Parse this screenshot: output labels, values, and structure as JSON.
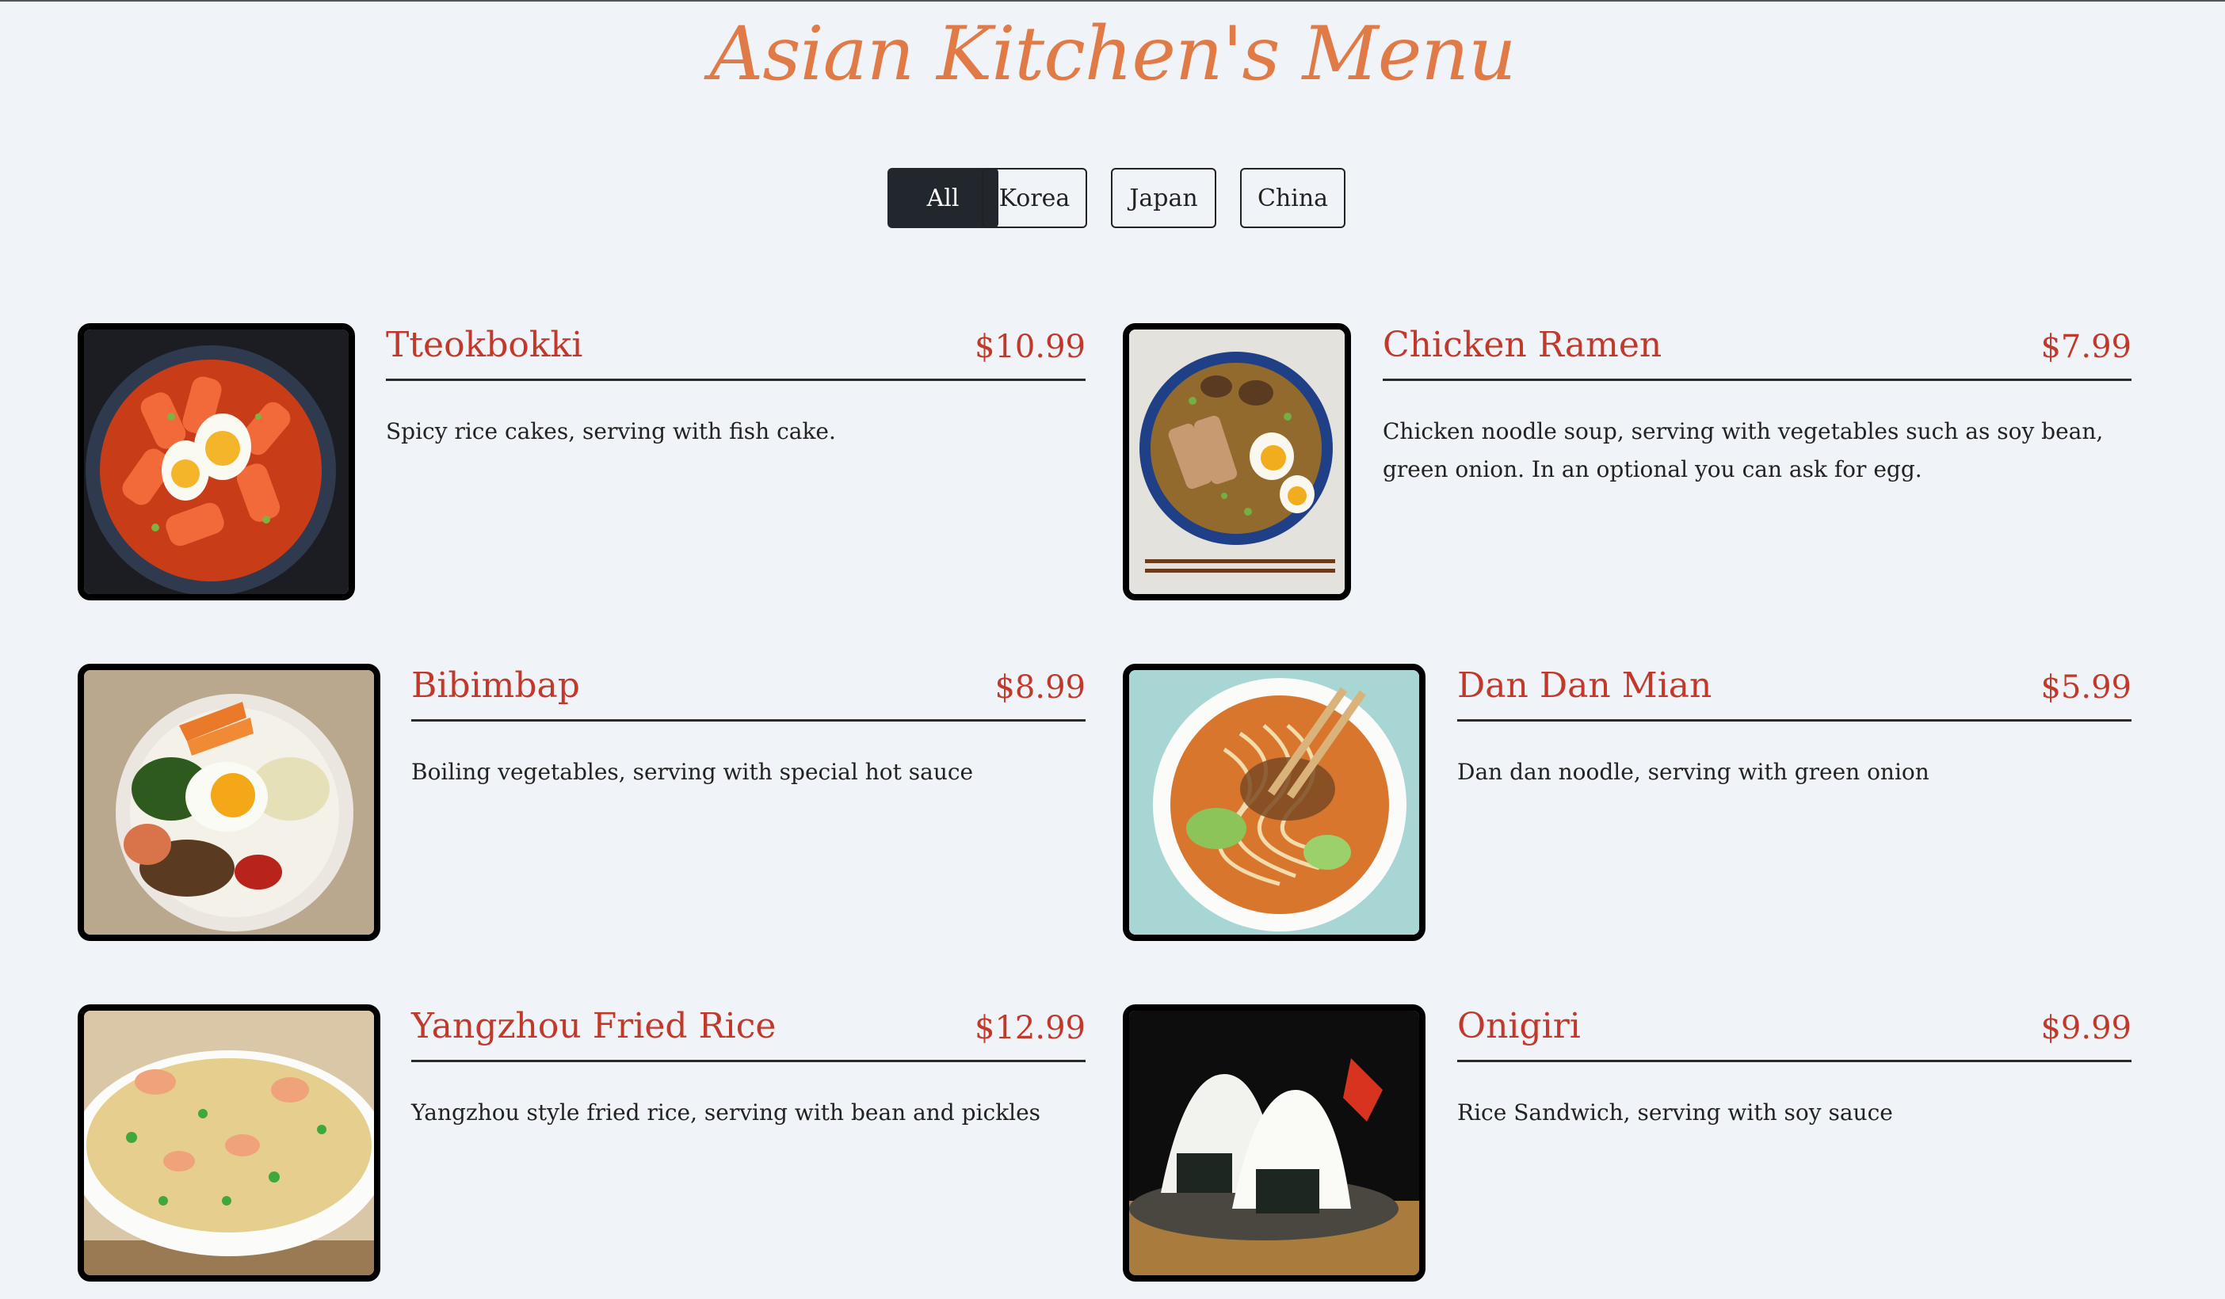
{
  "header": {
    "title": "Asian Kitchen's Menu"
  },
  "filters": [
    {
      "label": "All",
      "active": true
    },
    {
      "label": "Korea",
      "active": false
    },
    {
      "label": "Japan",
      "active": false
    },
    {
      "label": "China",
      "active": false
    }
  ],
  "menu": {
    "items": [
      {
        "name": "Tteokbokki",
        "price": "$10.99",
        "description": "Spicy rice cakes, serving with fish cake."
      },
      {
        "name": "Chicken Ramen",
        "price": "$7.99",
        "description": "Chicken noodle soup, serving with vegetables such as soy bean, green onion. In an optional you can ask for egg."
      },
      {
        "name": "Bibimbap",
        "price": "$8.99",
        "description": "Boiling vegetables, serving with special hot sauce"
      },
      {
        "name": "Dan Dan Mian",
        "price": "$5.99",
        "description": "Dan dan noodle, serving with green onion"
      },
      {
        "name": "Yangzhou Fried Rice",
        "price": "$12.99",
        "description": "Yangzhou style fried rice, serving with bean and pickles"
      },
      {
        "name": "Onigiri",
        "price": "$9.99",
        "description": "Rice Sandwich, serving with soy sauce"
      }
    ]
  }
}
